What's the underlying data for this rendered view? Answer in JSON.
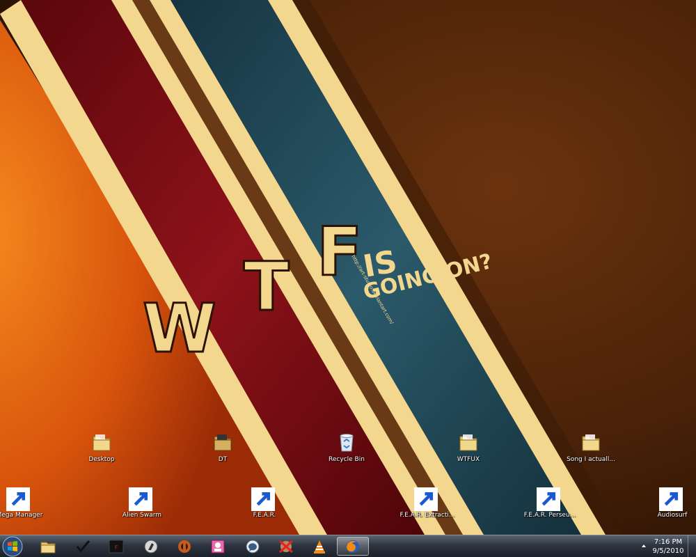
{
  "wallpaper": {
    "headline_letters": [
      "W",
      "T",
      "F"
    ],
    "headline_is": "IS",
    "headline_going": "GOING ON?",
    "credit": "http://art-studio.deviantart.com/"
  },
  "desktop_icons": [
    {
      "label": "Desktop",
      "icon": "folder-icon"
    },
    {
      "label": "DT",
      "icon": "folder-icon"
    },
    {
      "label": "Recycle Bin",
      "icon": "recycle-bin-icon"
    },
    {
      "label": "WTFUX",
      "icon": "folder-icon"
    },
    {
      "label": "Song I actuall...",
      "icon": "folder-icon"
    },
    {
      "label": "Mega Manager",
      "icon": "mega-manager-icon"
    },
    {
      "label": "Alien Swarm",
      "icon": "alien-swarm-icon"
    },
    {
      "label": "F.E.A.R.",
      "icon": "fear-eye-icon"
    },
    {
      "label": "F.E.A.R. Extracti...",
      "icon": "fear-eye-icon"
    },
    {
      "label": "F.E.A.R. Perseu...",
      "icon": "fear-eye-icon"
    },
    {
      "label": "Audiosurf",
      "icon": "audiosurf-icon"
    }
  ],
  "taskbar": {
    "pinned": [
      "windows-explorer-icon",
      "checkmark-app-icon",
      "fear-app-icon",
      "counter-strike-icon",
      "team-fortress-icon",
      "image-app-icon",
      "chat-app-icon",
      "crossed-app-icon",
      "vlc-icon",
      "firefox-icon"
    ],
    "clock": {
      "time": "7:16 PM",
      "date": "9/5/2010"
    }
  },
  "colors": {
    "stripe_cream": "#f4d78f",
    "stripe_red": "#7a0c12",
    "stripe_blue": "#1f4a5e",
    "bg_brown": "#4a2208",
    "bg_orange": "#e2640e"
  }
}
